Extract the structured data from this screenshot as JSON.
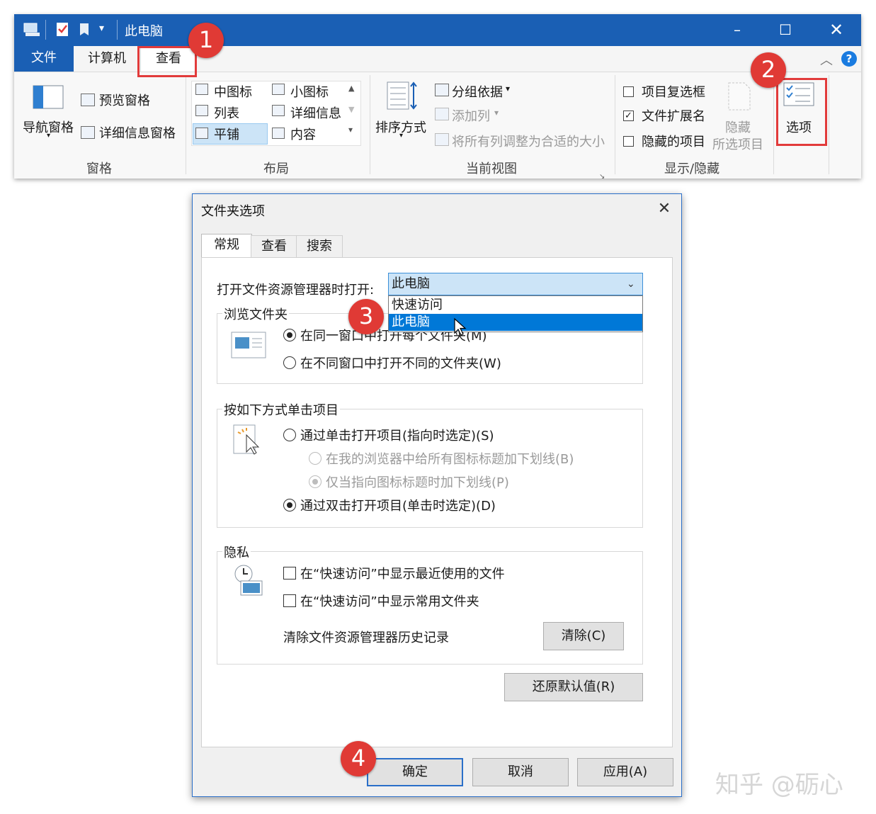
{
  "explorer": {
    "title": "此电脑",
    "tabs": {
      "file": "文件",
      "computer": "计算机",
      "view": "查看"
    },
    "panes": {
      "nav_pane": "导航窗格",
      "preview_pane": "预览窗格",
      "details_pane": "详细信息窗格",
      "group": "窗格"
    },
    "layout": {
      "medium_icons": "中图标",
      "small_icons": "小图标",
      "list": "列表",
      "details": "详细信息",
      "tiles": "平铺",
      "content": "内容",
      "group": "布局"
    },
    "current_view": {
      "sort_by": "排序方式",
      "group_by": "分组依据",
      "add_columns": "添加列",
      "size_all_columns": "将所有列调整为合适的大小",
      "group": "当前视图"
    },
    "show_hide": {
      "item_check_boxes": "项目复选框",
      "file_name_extensions": "文件扩展名",
      "hidden_items": "隐藏的项目",
      "hide_selected_1": "隐藏",
      "hide_selected_2": "所选项目",
      "group": "显示/隐藏",
      "file_name_extensions_checked": true
    },
    "options": "选项"
  },
  "badges": {
    "b1": "1",
    "b2": "2",
    "b3": "3",
    "b4": "4"
  },
  "dialog": {
    "title": "文件夹选项",
    "tabs": {
      "general": "常规",
      "view": "查看",
      "search": "搜索"
    },
    "open_label": "打开文件资源管理器时打开:",
    "open_value": "此电脑",
    "open_options": [
      "快速访问",
      "此电脑"
    ],
    "browse_group": "浏览文件夹",
    "browse_same": "在同一窗口中打开每个文件夹(M)",
    "browse_diff": "在不同窗口中打开不同的文件夹(W)",
    "click_group": "按如下方式单击项目",
    "single_click": "通过单击打开项目(指向时选定)(S)",
    "underline_all": "在我的浏览器中给所有图标标题加下划线(B)",
    "underline_point": "仅当指向图标标题时加下划线(P)",
    "double_click": "通过双击打开项目(单击时选定)(D)",
    "privacy_group": "隐私",
    "recent_files": "在“快速访问”中显示最近使用的文件",
    "frequent_folders": "在“快速访问”中显示常用文件夹",
    "clear_history": "清除文件资源管理器历史记录",
    "clear_btn": "清除(C)",
    "restore_btn": "还原默认值(R)",
    "ok_btn": "确定",
    "cancel_btn": "取消",
    "apply_btn": "应用(A)"
  },
  "watermark": "知乎 @砺心",
  "colors": {
    "accent": "#1a5fb4",
    "callout": "#e23b3b",
    "selection": "#0078d7"
  }
}
